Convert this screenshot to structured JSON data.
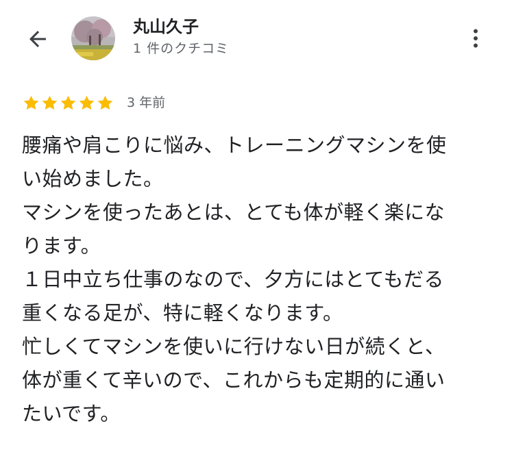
{
  "header": {
    "reviewer_name": "丸山久子",
    "review_count": "1 件のクチコミ"
  },
  "review": {
    "rating": 5,
    "rating_max": 5,
    "date": "3 年前",
    "star_color": "#FBBC04",
    "lines": [
      "腰痛や肩こりに悩み、トレーニングマシンを使",
      "い始めました。",
      "マシンを使ったあとは、とても体が軽く楽にな",
      "ります。",
      "１日中立ち仕事のなので、夕方にはとてもだる",
      "重くなる足が、特に軽くなります。",
      "忙しくてマシンを使いに行けない日が続くと、",
      "体が重くて辛いので、これからも定期的に通い",
      "たいです。"
    ]
  },
  "icons": {
    "back": "arrow-left-icon",
    "more": "more-vert-icon",
    "star": "star-icon"
  }
}
